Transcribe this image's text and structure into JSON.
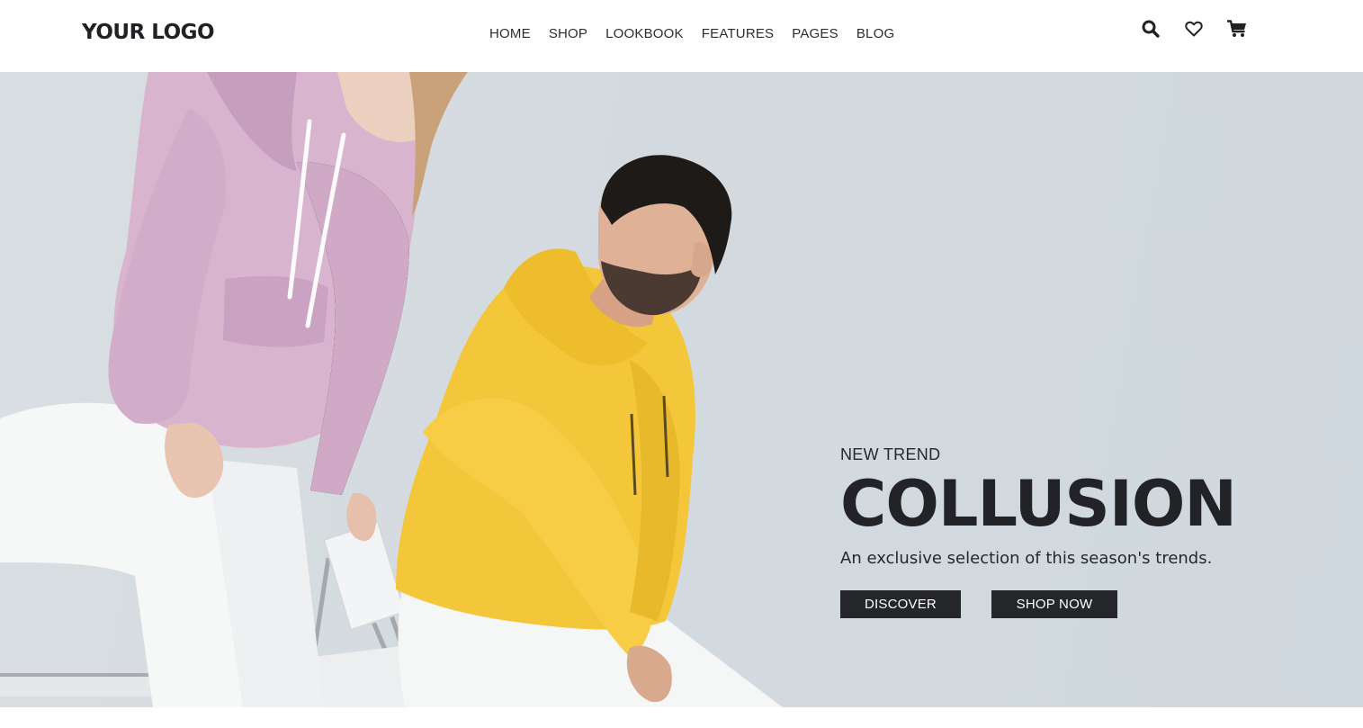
{
  "header": {
    "logo": "YOUR LOGO",
    "nav": [
      "HOME",
      "SHOP",
      "LOOKBOOK",
      "FEATURES",
      "PAGES",
      "BLOG"
    ],
    "icons": [
      "search-icon",
      "heart-icon",
      "cart-icon"
    ]
  },
  "hero": {
    "kicker": "NEW TREND",
    "headline": "COLLUSION",
    "subline": "An exclusive selection of this season's trends.",
    "buttons": {
      "discover": "DISCOVER",
      "shop_now": "SHOP NOW"
    }
  },
  "colors": {
    "dark": "#24262a",
    "hero_bg": "#d3dadf",
    "pink_hoodie": "#d8b4cf",
    "yellow_hoodie": "#f4c63a"
  }
}
